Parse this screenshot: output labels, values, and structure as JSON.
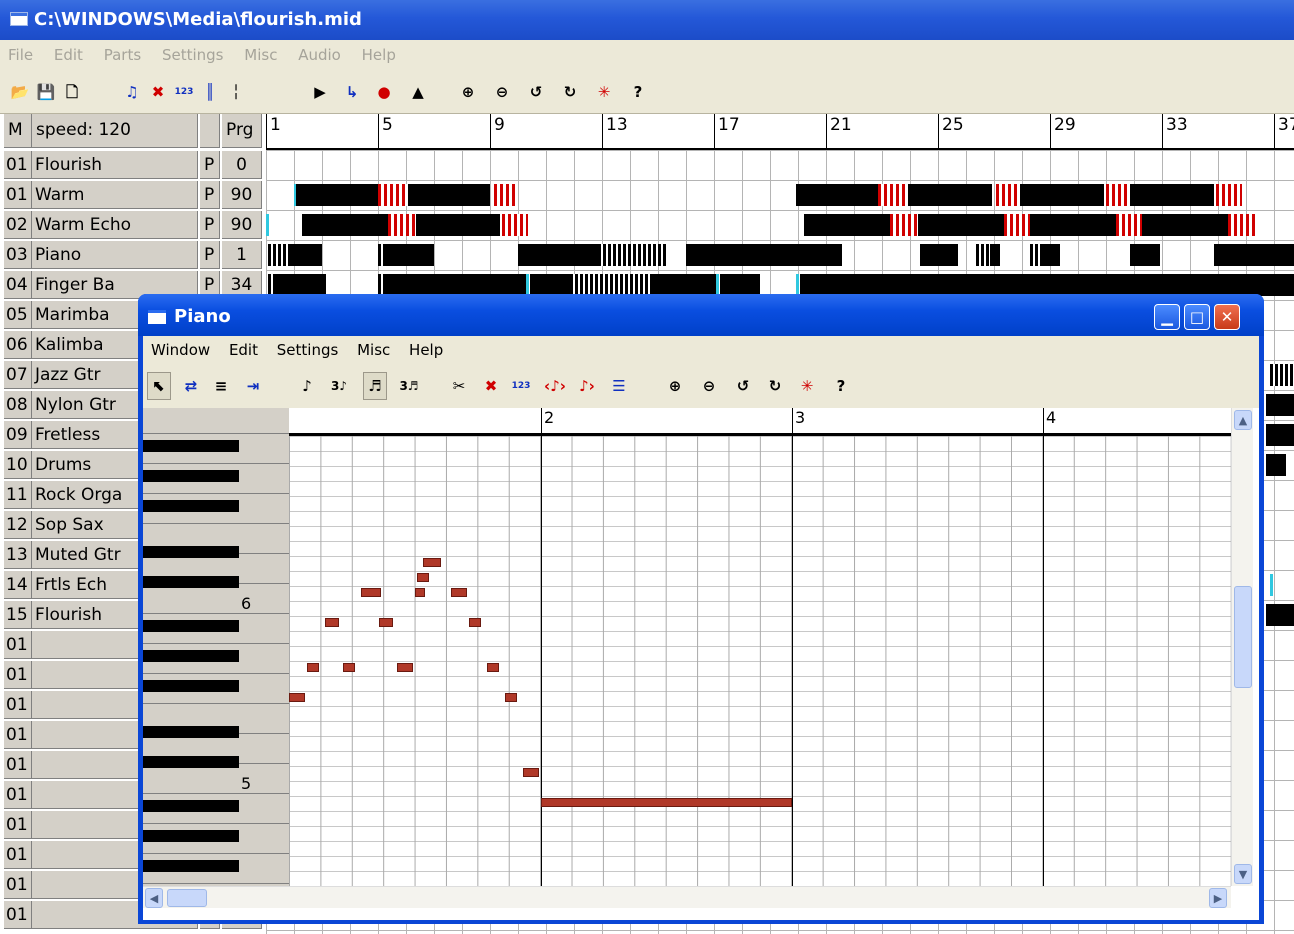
{
  "main_window": {
    "title": "C:\\WINDOWS\\Media\\flourish.mid",
    "menu": [
      "File",
      "Edit",
      "Parts",
      "Settings",
      "Misc",
      "Audio",
      "Help"
    ]
  },
  "track_header": {
    "m": "M",
    "speed": "speed: 120",
    "prg": "Prg",
    "ruler": [
      "1",
      "5",
      "9",
      "13",
      "17",
      "21",
      "25",
      "29",
      "33",
      "37"
    ]
  },
  "tracks": [
    {
      "num": "01",
      "name": "Flourish",
      "p": "P",
      "prg": "0"
    },
    {
      "num": "01",
      "name": "Warm",
      "p": "P",
      "prg": "90"
    },
    {
      "num": "02",
      "name": "Warm Echo",
      "p": "P",
      "prg": "90"
    },
    {
      "num": "03",
      "name": "Piano",
      "p": "P",
      "prg": "1"
    },
    {
      "num": "04",
      "name": "Finger Ba",
      "p": "P",
      "prg": "34"
    },
    {
      "num": "05",
      "name": "Marimba",
      "p": "",
      "prg": ""
    },
    {
      "num": "06",
      "name": "Kalimba",
      "p": "",
      "prg": ""
    },
    {
      "num": "07",
      "name": "Jazz Gtr",
      "p": "",
      "prg": ""
    },
    {
      "num": "08",
      "name": "Nylon Gtr",
      "p": "",
      "prg": ""
    },
    {
      "num": "09",
      "name": "Fretless",
      "p": "",
      "prg": ""
    },
    {
      "num": "10",
      "name": "Drums",
      "p": "",
      "prg": ""
    },
    {
      "num": "11",
      "name": "Rock Orga",
      "p": "",
      "prg": ""
    },
    {
      "num": "12",
      "name": "Sop Sax",
      "p": "",
      "prg": ""
    },
    {
      "num": "13",
      "name": "Muted Gtr",
      "p": "",
      "prg": ""
    },
    {
      "num": "14",
      "name": "Frtls Ech",
      "p": "",
      "prg": ""
    },
    {
      "num": "15",
      "name": "Flourish",
      "p": "",
      "prg": ""
    },
    {
      "num": "01",
      "name": "",
      "p": "",
      "prg": ""
    },
    {
      "num": "01",
      "name": "",
      "p": "",
      "prg": ""
    },
    {
      "num": "01",
      "name": "",
      "p": "",
      "prg": ""
    },
    {
      "num": "01",
      "name": "",
      "p": "",
      "prg": ""
    },
    {
      "num": "01",
      "name": "",
      "p": "",
      "prg": ""
    },
    {
      "num": "01",
      "name": "",
      "p": "",
      "prg": ""
    },
    {
      "num": "01",
      "name": "",
      "p": "",
      "prg": ""
    },
    {
      "num": "01",
      "name": "",
      "p": "",
      "prg": ""
    },
    {
      "num": "01",
      "name": "",
      "p": "",
      "prg": ""
    },
    {
      "num": "01",
      "name": "",
      "p": "",
      "prg": ""
    }
  ],
  "piano_window": {
    "title": "Piano",
    "menu": [
      "Window",
      "Edit",
      "Settings",
      "Misc",
      "Help"
    ],
    "ruler": [
      "2",
      "3",
      "4"
    ],
    "octave_labels": [
      "6",
      "5"
    ]
  },
  "icons": {
    "main_toolbar": [
      "open-folder-icon",
      "save-icon",
      "new-document-icon",
      "notes-icon",
      "delete-notes-icon",
      "numbering-icon",
      "grid-icon",
      "split-icon",
      "play-icon",
      "step-icon",
      "record-icon",
      "metronome-icon",
      "zoom-in-icon",
      "zoom-out-icon",
      "undo-icon",
      "redo-icon",
      "sparkle-icon",
      "help-icon"
    ],
    "piano_toolbar": [
      "select-icon",
      "swap-icon",
      "list-icon",
      "insert-icon",
      "eighth-note-icon",
      "triplet-icon",
      "sixteenth-note-icon",
      "triplet-sixteenth-icon",
      "cut-icon",
      "delete-icon",
      "numbering-icon",
      "shift-left-icon",
      "shift-right-icon",
      "quantize-icon",
      "zoom-in-icon",
      "zoom-out-icon",
      "undo-icon",
      "redo-icon",
      "sparkle-icon",
      "help-icon"
    ]
  },
  "colors": {
    "titlebar": "#2458d8",
    "note": "#b03828",
    "track_red": "#d00000",
    "track_block": "#000000"
  }
}
